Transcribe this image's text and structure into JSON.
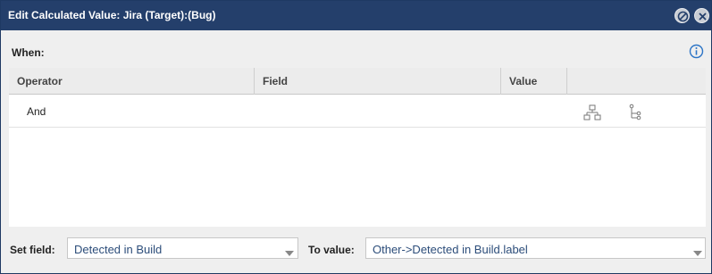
{
  "dialog": {
    "title": "Edit Calculated Value: Jira (Target):(Bug)",
    "minimize_icon": "circle-slash-icon",
    "close_icon": "close-icon"
  },
  "when": {
    "label": "When:",
    "info_icon": "info-icon"
  },
  "grid": {
    "columns": [
      "Operator",
      "Field",
      "Value",
      ""
    ],
    "rows": [
      {
        "operator": "And",
        "field": "",
        "value": "",
        "icons": [
          "add-group-icon",
          "add-condition-icon"
        ]
      }
    ]
  },
  "footer": {
    "set_field_label": "Set field:",
    "set_field_value": "Detected in Build",
    "to_value_label": "To value:",
    "to_value_value": "Other->Detected in Build.label"
  },
  "colors": {
    "title_bar": "#243f6b",
    "info_blue": "#2b74c6",
    "select_text": "#2c4d7a"
  }
}
